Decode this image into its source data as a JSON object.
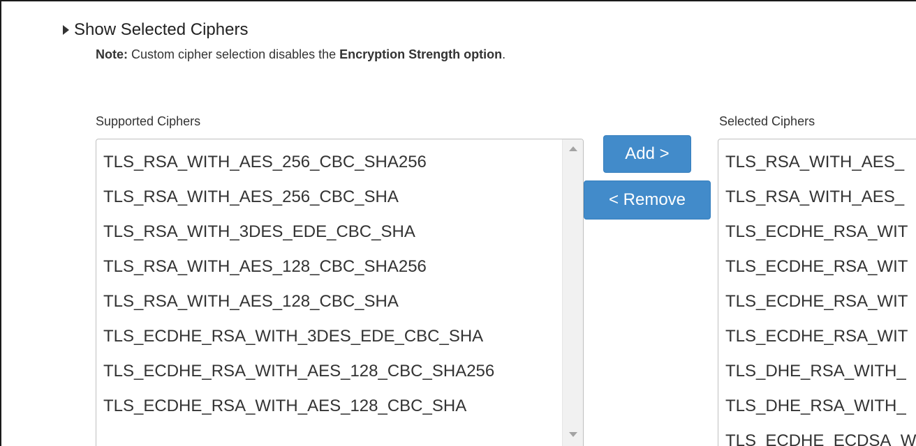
{
  "toggle": {
    "label": "Show Selected Ciphers"
  },
  "note": {
    "prefix": "Note:",
    "text_before": " Custom cipher selection disables the ",
    "emphasis": "Encryption Strength option",
    "text_after": "."
  },
  "supported": {
    "label": "Supported Ciphers",
    "options": [
      "TLS_RSA_WITH_AES_256_CBC_SHA256",
      "TLS_RSA_WITH_AES_256_CBC_SHA",
      "TLS_RSA_WITH_3DES_EDE_CBC_SHA",
      "TLS_RSA_WITH_AES_128_CBC_SHA256",
      "TLS_RSA_WITH_AES_128_CBC_SHA",
      "TLS_ECDHE_RSA_WITH_3DES_EDE_CBC_SHA",
      "TLS_ECDHE_RSA_WITH_AES_128_CBC_SHA256",
      "TLS_ECDHE_RSA_WITH_AES_128_CBC_SHA"
    ]
  },
  "buttons": {
    "add_label": "Add >",
    "remove_label": "< Remove",
    "color": "#428bca"
  },
  "selected": {
    "label": "Selected Ciphers",
    "options": [
      "TLS_RSA_WITH_AES_",
      "TLS_RSA_WITH_AES_",
      "TLS_ECDHE_RSA_WIT",
      "TLS_ECDHE_RSA_WIT",
      "TLS_ECDHE_RSA_WIT",
      "TLS_ECDHE_RSA_WIT",
      "TLS_DHE_RSA_WITH_",
      "TLS_DHE_RSA_WITH_",
      "TLS_ECDHE_ECDSA_W"
    ]
  },
  "icons": {
    "toggle": "caret-right-icon",
    "scroll_up": "scroll-up-arrow-icon",
    "scroll_down": "scroll-down-arrow-icon"
  }
}
